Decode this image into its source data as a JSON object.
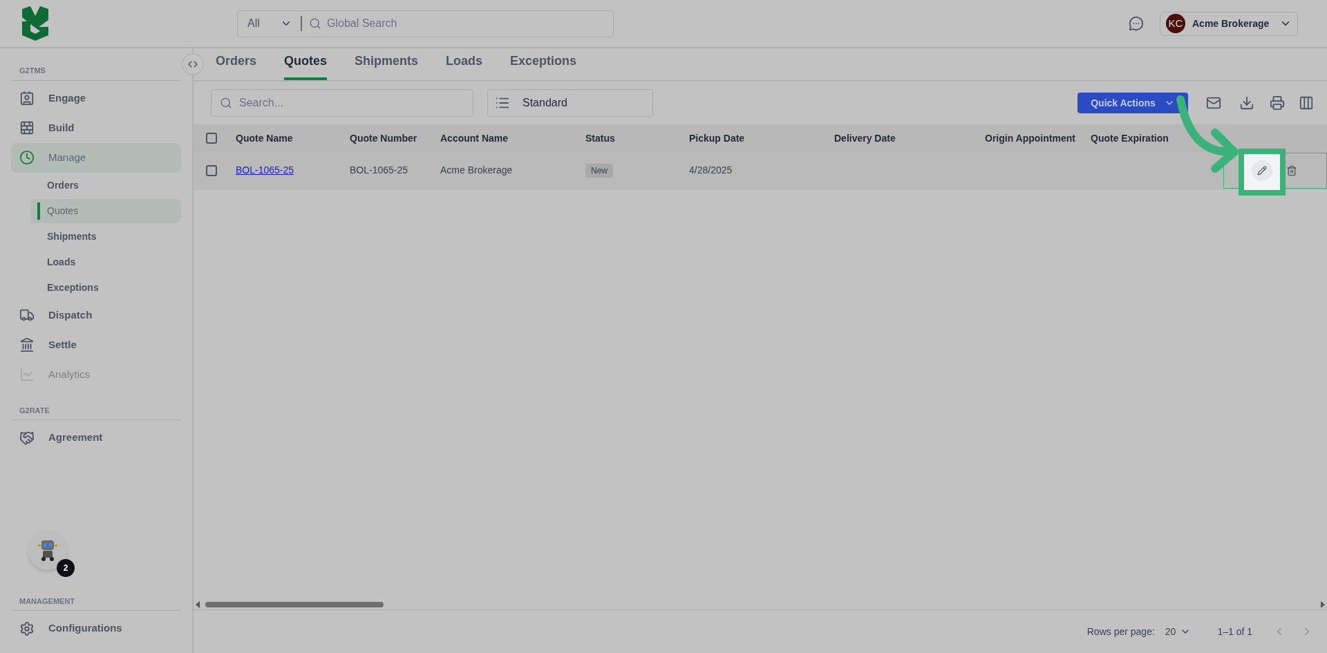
{
  "header": {
    "search": {
      "scope": "All",
      "placeholder": "Global Search"
    },
    "account": {
      "initials": "KC",
      "name": "Acme Brokerage"
    }
  },
  "sidebar": {
    "sections": [
      {
        "title": "G2TMS",
        "items": [
          {
            "label": "Engage",
            "selected": false,
            "disabled": false
          },
          {
            "label": "Build",
            "selected": false,
            "disabled": false
          },
          {
            "label": "Manage",
            "selected": true,
            "disabled": false,
            "children": [
              {
                "label": "Orders",
                "selected": false
              },
              {
                "label": "Quotes",
                "selected": true
              },
              {
                "label": "Shipments",
                "selected": false
              },
              {
                "label": "Loads",
                "selected": false
              },
              {
                "label": "Exceptions",
                "selected": false
              }
            ]
          },
          {
            "label": "Dispatch",
            "selected": false,
            "disabled": false
          },
          {
            "label": "Settle",
            "selected": false,
            "disabled": false
          },
          {
            "label": "Analytics",
            "selected": false,
            "disabled": true
          }
        ]
      },
      {
        "title": "G2RATE",
        "items": [
          {
            "label": "Agreement",
            "selected": false,
            "disabled": false
          }
        ]
      },
      {
        "title": "MANAGEMENT",
        "items": [
          {
            "label": "Configurations",
            "selected": false,
            "disabled": false
          }
        ]
      }
    ]
  },
  "tabs": [
    {
      "label": "Orders",
      "selected": false
    },
    {
      "label": "Quotes",
      "selected": true
    },
    {
      "label": "Shipments",
      "selected": false
    },
    {
      "label": "Loads",
      "selected": false
    },
    {
      "label": "Exceptions",
      "selected": false
    }
  ],
  "toolbar": {
    "search_placeholder": "Search...",
    "view": "Standard",
    "quick_actions": "Quick Actions"
  },
  "table": {
    "select_all_checked": false,
    "columns": [
      {
        "label": "Quote Name",
        "kind": "link"
      },
      {
        "label": "Quote Number",
        "kind": "text"
      },
      {
        "label": "Account Name",
        "kind": "text"
      },
      {
        "label": "Status",
        "kind": "badge"
      },
      {
        "label": "Pickup Date",
        "kind": "text"
      },
      {
        "label": "Delivery Date",
        "kind": "text"
      },
      {
        "label": "Origin Appointment",
        "kind": "text"
      },
      {
        "label": "Quote Expiration",
        "kind": "text"
      }
    ],
    "rows": [
      {
        "checked": false,
        "cells": [
          "BOL-1065-25",
          "BOL-1065-25",
          "Acme Brokerage",
          "New",
          "4/28/2025",
          "",
          "",
          ""
        ]
      }
    ]
  },
  "pagination": {
    "rows_per_page_label": "Rows per page:",
    "rows_per_page": "20",
    "range": "1–1 of 1"
  },
  "guide": {
    "badge": "2"
  }
}
